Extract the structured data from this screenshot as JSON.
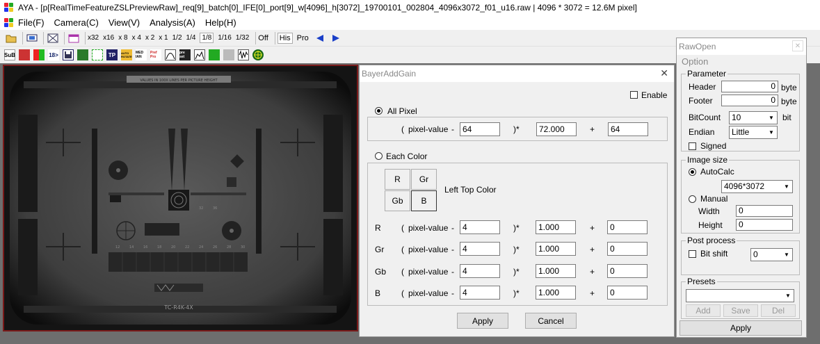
{
  "window": {
    "title": "AYA - [p[RealTimeFeatureZSLPreviewRaw]_req[9]_batch[0]_IFE[0]_port[9]_w[4096]_h[3072]_19700101_002804_4096x3072_f01_u16.raw | 4096 * 3072 = 12.6M pixel]"
  },
  "menu": [
    "File(F)",
    "Camera(C)",
    "View(V)",
    "Analysis(A)",
    "Help(H)"
  ],
  "toolbar": {
    "zoom": [
      "x32",
      "x16",
      "x 8",
      "x 4",
      "x 2",
      "x 1",
      "1/2",
      "1/4",
      "1/8",
      "1/16",
      "1/32"
    ],
    "active_zoom": "1/8",
    "off": "Off",
    "his": "His",
    "pro": "Pro"
  },
  "toolbar2_labels": {
    "sub": "SuB",
    "bit": "18>",
    "tp": "TP",
    "auto_rotate": "AUTO ROTATE",
    "median": "MED IAN",
    "pref": "Pref Pro",
    "preset": "pre set"
  },
  "image": {
    "chart_top_text": "VALUES IN 100X LINES PER PICTURE HEIGHT",
    "chart_bottom_text": "TC-R4K-4X",
    "tick_labels": [
      "12",
      "14",
      "16",
      "18",
      "20",
      "22",
      "24",
      "26",
      "28",
      "30",
      "32",
      "36"
    ]
  },
  "bayer_dialog": {
    "title": "BayerAddGain",
    "enable_label": "Enable",
    "all_pixel_label": "All Pixel",
    "each_color_label": "Each Color",
    "open_paren": "(",
    "pixel_value_label": "pixel-value",
    "minus": "-",
    "mult": ")*",
    "plus": "+",
    "all_pixel": {
      "offset": "64",
      "gain": "72.000",
      "add": "64"
    },
    "cfa_buttons": [
      "R",
      "Gr",
      "Gb",
      "B"
    ],
    "left_top_color_label": "Left Top Color",
    "rows": [
      {
        "label": "R",
        "offset": "4",
        "gain": "1.000",
        "add": "0"
      },
      {
        "label": "Gr",
        "offset": "4",
        "gain": "1.000",
        "add": "0"
      },
      {
        "label": "Gb",
        "offset": "4",
        "gain": "1.000",
        "add": "0"
      },
      {
        "label": "B",
        "offset": "4",
        "gain": "1.000",
        "add": "0"
      }
    ],
    "apply": "Apply",
    "cancel": "Cancel"
  },
  "raw_open": {
    "title": "RawOpen",
    "option": "Option",
    "parameter": {
      "legend": "Parameter",
      "header_label": "Header",
      "header_value": "0",
      "header_unit": "byte",
      "footer_label": "Footer",
      "footer_value": "0",
      "footer_unit": "byte",
      "bitcount_label": "BitCount",
      "bitcount_value": "10",
      "bitcount_unit": "bit",
      "endian_label": "Endian",
      "endian_value": "Little",
      "signed_label": "Signed"
    },
    "image_size": {
      "legend": "Image size",
      "autocalc_label": "AutoCalc",
      "autocalc_value": "4096*3072",
      "manual_label": "Manual",
      "width_label": "Width",
      "width_value": "0",
      "height_label": "Height",
      "height_value": "0"
    },
    "post_process": {
      "legend": "Post process",
      "bitshift_label": "Bit shift",
      "bitshift_value": "0"
    },
    "presets": {
      "legend": "Presets",
      "add": "Add",
      "save": "Save",
      "del": "Del"
    },
    "apply": "Apply"
  }
}
